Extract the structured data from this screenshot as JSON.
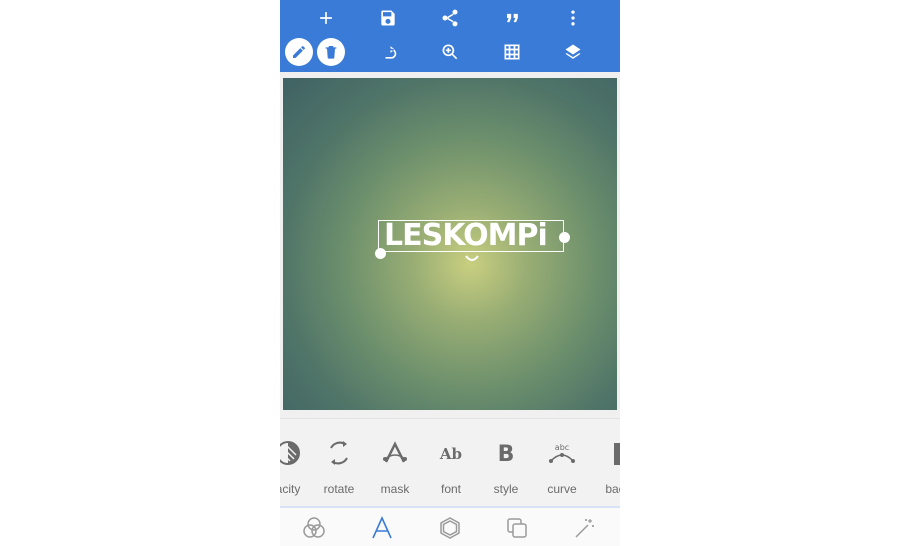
{
  "app": {
    "toolbar_top": [
      "add-icon",
      "save-icon",
      "share-icon",
      "quote-icon",
      "more-vert-icon"
    ],
    "toolbar_second": [
      "pencil-icon",
      "trash-icon",
      "undo-icon",
      "zoom-in-icon",
      "grid-icon",
      "layers-icon"
    ]
  },
  "canvas": {
    "text_value": "LESKOMPi"
  },
  "tools": [
    {
      "label": "acity",
      "icon": "opacity-icon"
    },
    {
      "label": "rotate",
      "icon": "rotate-icon"
    },
    {
      "label": "mask",
      "icon": "mask-icon"
    },
    {
      "label": "font",
      "icon": "font-icon"
    },
    {
      "label": "style",
      "icon": "style-bold-icon"
    },
    {
      "label": "curve",
      "icon": "curve-icon"
    },
    {
      "label": "back",
      "icon": "background-icon"
    }
  ],
  "tool_glyphs": {
    "font": "Ab",
    "style": "B",
    "curve": "abc"
  },
  "bottom_nav": [
    "blend-icon",
    "text-icon",
    "shape-icon",
    "duplicate-icon",
    "effects-wand-icon"
  ],
  "colors": {
    "toolbar": "#3a7bd8",
    "accent": "#3a7bd8",
    "tool_gray": "#6b6b6b"
  }
}
